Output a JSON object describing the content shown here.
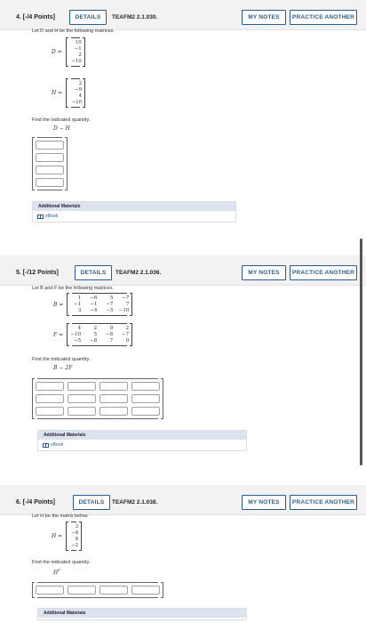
{
  "q4": {
    "number": "4. [-/4 Points]",
    "details": "DETAILS",
    "code": "TEAFM2 2.1.030.",
    "my_notes": "MY NOTES",
    "practice": "PRACTICE ANOTHER",
    "intro": "Let D and H be the following matrices.",
    "D_label": "D =",
    "D": [
      "10",
      "−1",
      "2",
      "−10"
    ],
    "H_label": "H =",
    "H": [
      "2",
      "−9",
      "4",
      "−10"
    ],
    "find": "Find the indicated quantity.",
    "expr": "D − H",
    "additional": "Additional Materials",
    "ebook": "eBook"
  },
  "q5": {
    "number": "5. [-/12 Points]",
    "details": "DETAILS",
    "code": "TEAFM2 2.1.036.",
    "my_notes": "MY NOTES",
    "practice": "PRACTICE ANOTHER",
    "intro": "Let B and F be the following matrices.",
    "B_label": "B =",
    "B": [
      [
        "1",
        "−6",
        "5",
        "−7"
      ],
      [
        "−1",
        "−1",
        "−7",
        "7"
      ],
      [
        "3",
        "−4",
        "−5",
        "−10"
      ]
    ],
    "F_label": "F =",
    "F": [
      [
        "4",
        "2",
        "9",
        "2"
      ],
      [
        "−10",
        "5",
        "−8",
        "−7"
      ],
      [
        "−5",
        "−8",
        "7",
        "0"
      ]
    ],
    "find": "Find the indicated quantity.",
    "expr": "B − 2F",
    "additional": "Additional Materials",
    "ebook": "eBook"
  },
  "q6": {
    "number": "6. [-/4 Points]",
    "details": "DETAILS",
    "code": "TEAFM2 2.1.038.",
    "my_notes": "MY NOTES",
    "practice": "PRACTICE ANOTHER",
    "intro": "Let H be the matrix below.",
    "H_label": "H =",
    "H": [
      "3",
      "−8",
      "8",
      "−2"
    ],
    "find": "Find the indicated quantity.",
    "expr": "H",
    "expr_sup": "T",
    "additional": "Additional Materials"
  }
}
